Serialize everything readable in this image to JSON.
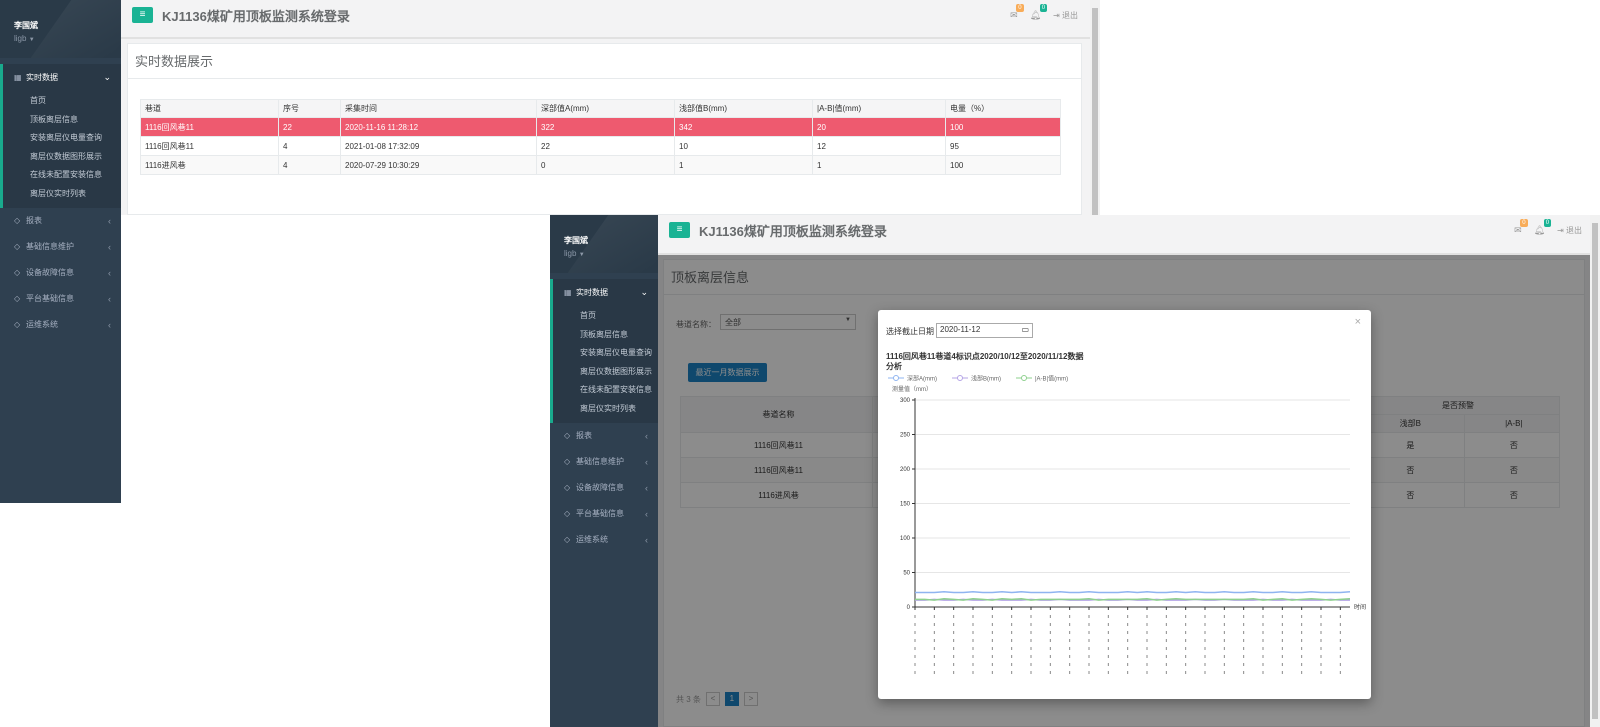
{
  "app": {
    "title": "KJ1136煤矿用顶板监测系统登录",
    "menu_button": "≡",
    "logout_label": "退出",
    "mail_badge": "0",
    "bell_badge": "0",
    "accent_color": "#1ab394",
    "alarm_color": "#ee5a6f"
  },
  "sidebar": {
    "user_name": "李国斌",
    "account": "ligb",
    "active_group": "实时数据",
    "sub_items": [
      "首页",
      "顶板离层信息",
      "安装离层仪电量查询",
      "离层仪数据图形展示",
      "在线未配置安装信息",
      "离层仪实时列表"
    ],
    "groups": [
      "报表",
      "基础信息维护",
      "设备故障信息",
      "平台基础信息",
      "运维系统"
    ]
  },
  "realtime": {
    "panel_title": "实时数据展示",
    "columns": [
      "巷道",
      "序号",
      "采集时间",
      "深部值A(mm)",
      "浅部值B(mm)",
      "|A-B|值(mm)",
      "电量（%）"
    ],
    "rows": [
      [
        "1116回风巷11",
        "22",
        "2020-11-16 11:28:12",
        "322",
        "342",
        "20",
        "100"
      ],
      [
        "1116回风巷11",
        "4",
        "2021-01-08 17:32:09",
        "22",
        "10",
        "12",
        "95"
      ],
      [
        "1116进风巷",
        "4",
        "2020-07-29 10:30:29",
        "0",
        "1",
        "1",
        "100"
      ]
    ],
    "alarm_row": 0
  },
  "layer_info": {
    "panel_title": "顶板离层信息",
    "filter_label": "巷道名称：",
    "filter_value": "全部",
    "recent_button": "最近一月数据展示",
    "col_lane": "巷道名称",
    "col_warning": "是否预警",
    "col_b": "浅部B",
    "col_ab": "|A-B|",
    "rows": [
      {
        "lane": "1116回风巷11",
        "b": "是",
        "ab": "否"
      },
      {
        "lane": "1116回风巷11",
        "b": "否",
        "ab": "否"
      },
      {
        "lane": "1116进风巷",
        "b": "否",
        "ab": "否"
      }
    ],
    "total": "共 3 条",
    "page": "1",
    "prev": "<",
    "next": ">"
  },
  "modal": {
    "close": "×",
    "date_label": "选择截止日期",
    "date_value": "2020-11-12",
    "calendar_icon": "▭",
    "chart_title_line1": "1116回风巷11巷道4标识点2020/10/12至2020/11/12数据",
    "chart_title_line2": "分析"
  },
  "chart_data": {
    "type": "line",
    "ylabel": "测量值（mm）",
    "xlabel": "时间",
    "ylim": [
      0,
      300
    ],
    "yticks": [
      0,
      50,
      100,
      150,
      200,
      250,
      300
    ],
    "grid": true,
    "legend_position": "top-left",
    "series": [
      {
        "name": "深部A(mm)",
        "color": "#8fb4f0",
        "values": [
          21,
          21,
          21,
          22,
          21,
          21,
          22,
          21,
          21,
          22,
          21,
          22,
          21,
          21,
          21,
          22,
          21,
          21,
          22,
          21,
          21,
          21,
          22,
          21,
          22,
          21,
          21,
          22,
          21,
          22,
          21,
          21,
          22,
          21,
          21,
          22,
          21,
          21,
          22,
          21,
          21,
          22,
          21,
          21,
          21,
          22
        ]
      },
      {
        "name": "浅部B(mm)",
        "color": "#b4a4e6",
        "values": [
          10,
          10,
          11,
          10,
          10,
          11,
          10,
          10,
          11,
          10,
          10,
          10,
          11,
          10,
          10,
          11,
          10,
          10,
          10,
          11,
          10,
          10,
          11,
          10,
          10,
          11,
          10,
          10,
          10,
          11,
          10,
          10,
          11,
          10,
          10,
          10,
          11,
          10,
          10,
          11,
          10,
          10,
          10,
          11,
          10,
          10
        ]
      },
      {
        "name": "|A-B|值(mm)",
        "color": "#8ed08e",
        "values": [
          11,
          11,
          10,
          12,
          11,
          10,
          12,
          11,
          10,
          12,
          11,
          12,
          10,
          11,
          11,
          11,
          11,
          11,
          12,
          10,
          11,
          11,
          11,
          11,
          12,
          10,
          11,
          12,
          11,
          11,
          11,
          11,
          11,
          11,
          11,
          12,
          10,
          11,
          12,
          10,
          11,
          12,
          11,
          10,
          11,
          12
        ]
      }
    ]
  }
}
